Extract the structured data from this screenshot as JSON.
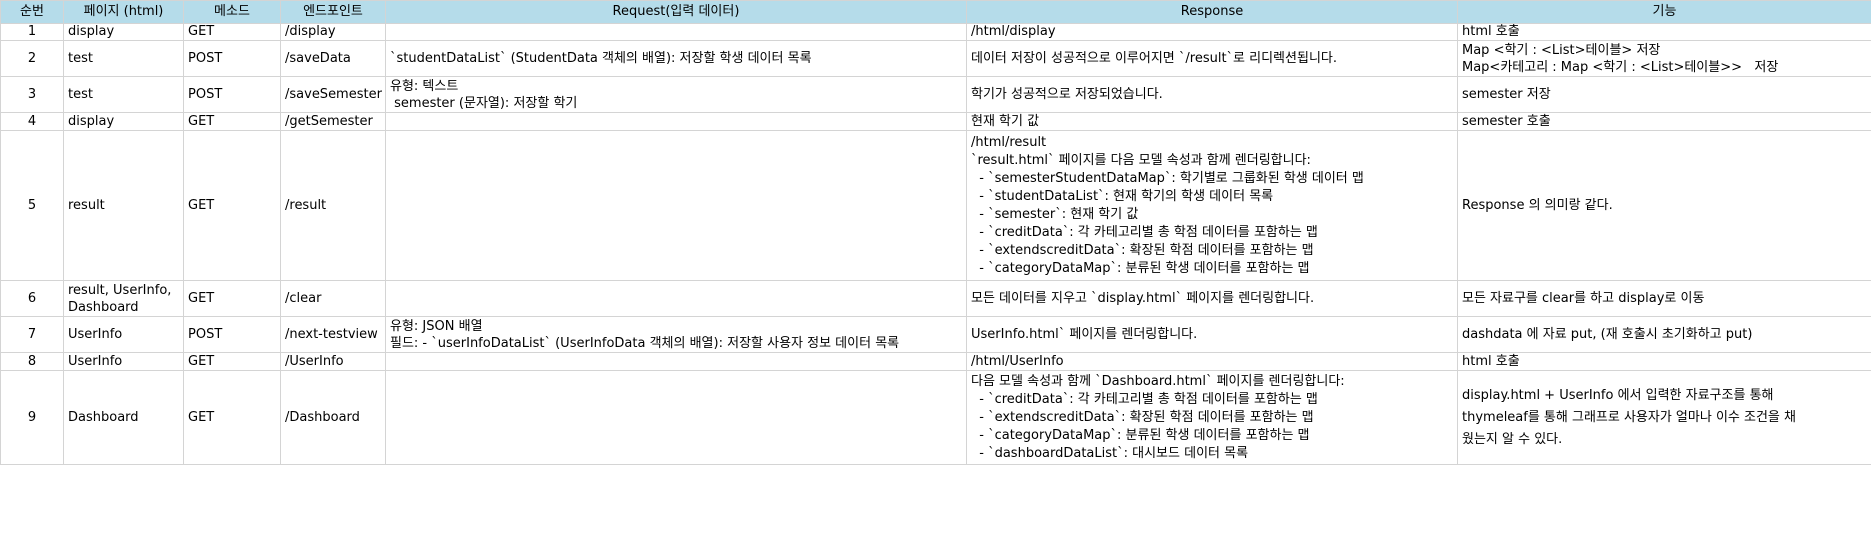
{
  "headers": [
    "순번",
    "페이지 (html)",
    "메소드",
    "엔드포인트",
    "Request(입력 데이터)",
    "Response",
    "기능"
  ],
  "rows": [
    {
      "no": "1",
      "page": [
        "display"
      ],
      "method": "GET",
      "endpoint": "/display",
      "request": [],
      "response": [
        "/html/display"
      ],
      "feature": [
        "html 호출"
      ]
    },
    {
      "no": "2",
      "page": [
        "test"
      ],
      "method": "POST",
      "endpoint": "/saveData",
      "request": [
        "`studentDataList` (StudentData 객체의 배열): 저장할 학생 데이터 목록"
      ],
      "response": [
        "데이터 저장이 성공적으로 이루어지면 `/result`로 리디렉션됩니다."
      ],
      "feature": [
        "Map <학기 : <List>테이블> 저장",
        "Map<카테고리 : Map <학기 : <List>테이블>>   저장"
      ]
    },
    {
      "no": "3",
      "page": [
        "test"
      ],
      "method": "POST",
      "endpoint": "/saveSemester",
      "request": [
        "유형: 텍스트",
        " semester (문자열): 저장할 학기"
      ],
      "response": [
        "학기가 성공적으로 저장되었습니다."
      ],
      "feature": [
        "semester 저장"
      ]
    },
    {
      "no": "4",
      "page": [
        "display"
      ],
      "method": "GET",
      "endpoint": "/getSemester",
      "request": [],
      "response": [
        "현재 학기 값"
      ],
      "feature": [
        "semester 호출"
      ]
    },
    {
      "no": "5",
      "page": [
        "result"
      ],
      "method": "GET",
      "endpoint": "/result",
      "request": [],
      "response": [
        "/html/result",
        "`result.html` 페이지를 다음 모델 속성과 함께 렌더링합니다:",
        "  - `semesterStudentDataMap`: 학기별로 그룹화된 학생 데이터 맵",
        "  - `studentDataList`: 현재 학기의 학생 데이터 목록",
        "  - `semester`: 현재 학기 값",
        "  - `creditData`: 각 카테고리별 총 학점 데이터를 포함하는 맵",
        "  - `extendscreditData`: 확장된 학점 데이터를 포함하는 맵",
        "  - `categoryDataMap`: 분류된 학생 데이터를 포함하는 맵"
      ],
      "feature": [
        "Response 의 의미랑 같다."
      ]
    },
    {
      "no": "6",
      "page": [
        "result, UserInfo,",
        "Dashboard"
      ],
      "method": "GET",
      "endpoint": "/clear",
      "request": [],
      "response": [
        "모든 데이터를 지우고 `display.html` 페이지를 렌더링합니다."
      ],
      "feature": [
        "모든 자료구를 clear를 하고 display로 이동"
      ]
    },
    {
      "no": "7",
      "page": [
        "UserInfo"
      ],
      "method": "POST",
      "endpoint": "/next-testview",
      "request": [
        "유형: JSON 배열",
        "필드: - `userInfoDataList` (UserInfoData 객체의 배열): 저장할 사용자 정보 데이터 목록"
      ],
      "response": [
        "UserInfo.html` 페이지를 렌더링합니다."
      ],
      "feature": [
        "dashdata 에 자료 put, (재 호출시 초기화하고 put)"
      ]
    },
    {
      "no": "8",
      "page": [
        "UserInfo"
      ],
      "method": "GET",
      "endpoint": "/UserInfo",
      "request": [],
      "response": [
        "/html/UserInfo"
      ],
      "feature": [
        "html 호출"
      ]
    },
    {
      "no": "9",
      "page": [
        "Dashboard"
      ],
      "method": "GET",
      "endpoint": "/Dashboard",
      "request": [],
      "response": [
        "다음 모델 속성과 함께 `Dashboard.html` 페이지를 렌더링합니다:",
        "  - `creditData`: 각 카테고리별 총 학점 데이터를 포함하는 맵",
        "  - `extendscreditData`: 확장된 학점 데이터를 포함하는 맵",
        "  - `categoryDataMap`: 분류된 학생 데이터를 포함하는 맵",
        "  - `dashboardDataList`: 대시보드 데이터 목록"
      ],
      "feature": [
        "display.html + UserInfo 에서 입력한 자료구조를 통해",
        "thymeleaf를 통해 그래프로 사용자가 얼마나 이수 조건을 채",
        "웠는지 알 수 있다."
      ]
    }
  ]
}
